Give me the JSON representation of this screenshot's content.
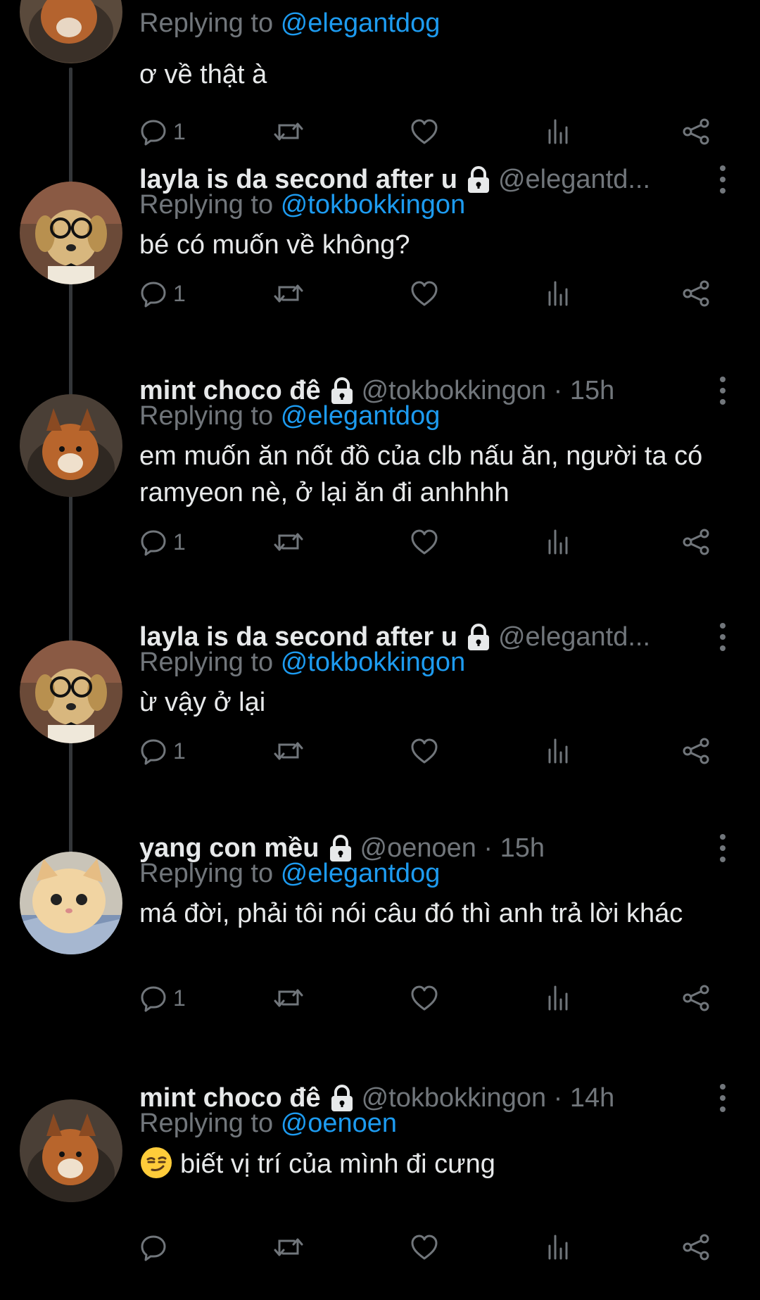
{
  "thread": {
    "tweets": [
      {
        "display_name": "",
        "handle": "",
        "time": "",
        "locked": false,
        "reply_prefix": "Replying to",
        "reply_to": "@elegantdog",
        "text": "ơ về thật à",
        "reply_count": "1",
        "avatar": "fox"
      },
      {
        "display_name": "layla is da second after u",
        "handle": "@elegantd...",
        "time": "",
        "locked": true,
        "reply_prefix": "Replying to",
        "reply_to": "@tokbokkingon",
        "text": "bé có muốn về không?",
        "reply_count": "1",
        "avatar": "dog-glasses"
      },
      {
        "display_name": "mint choco đê",
        "handle": "@tokbokkingon · 15h",
        "time": "15h",
        "locked": true,
        "reply_prefix": "Replying to",
        "reply_to": "@elegantdog",
        "text": "em muốn ăn nốt đồ của clb nấu ăn, người ta có ramyeon nè, ở lại ăn đi anhhhh",
        "reply_count": "1",
        "avatar": "fox"
      },
      {
        "display_name": "layla is da second after u",
        "handle": "@elegantd...",
        "time": "",
        "locked": true,
        "reply_prefix": "Replying to",
        "reply_to": "@tokbokkingon",
        "text": "ừ vậy ở lại",
        "reply_count": "1",
        "avatar": "dog-glasses"
      },
      {
        "display_name": "yang con mều",
        "handle": "@oenoen · 15h",
        "time": "15h",
        "locked": true,
        "reply_prefix": "Replying to",
        "reply_to": "@elegantdog",
        "text": "má đời, phải tôi nói câu đó thì anh trả lời khác",
        "reply_count": "1",
        "avatar": "cat"
      },
      {
        "display_name": "mint choco đê",
        "handle": "@tokbokkingon · 14h",
        "time": "14h",
        "locked": true,
        "reply_prefix": "Replying to",
        "reply_to": "@oenoen",
        "text": "biết vị trí của mình đi cưng",
        "text_emoji": "smirking-face",
        "reply_count": "",
        "avatar": "fox"
      }
    ]
  },
  "icons": {
    "reply": "reply-icon",
    "retweet": "retweet-icon",
    "like": "like-icon",
    "views": "views-icon",
    "share": "share-icon",
    "more": "more-options-icon",
    "lock": "lock-icon"
  },
  "colors": {
    "background": "#000000",
    "text": "#e7e9ea",
    "muted": "#71767b",
    "mention": "#1d9bf0",
    "thread_line": "#333639"
  }
}
